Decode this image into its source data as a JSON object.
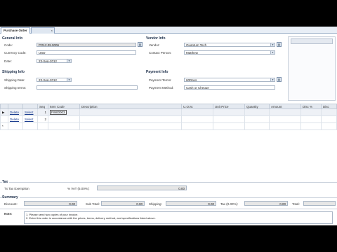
{
  "tabs": [
    "Purchase Order",
    ""
  ],
  "general": {
    "title": "General Info",
    "code_label": "Code:",
    "code_value": "PO12.09.0006",
    "currency_label": "Currency Code:",
    "currency_value": "USD",
    "date_label": "Date:",
    "date_value": "23-Sep-2012"
  },
  "vendor": {
    "title": "Vendor Info",
    "vendor_label": "Vendor:",
    "vendor_value": "Quantum Tech",
    "contact_label": "Contact Person:",
    "contact_value": "Matthew"
  },
  "shipping": {
    "title": "Shipping Info",
    "date_label": "Shipping Date:",
    "date_value": "23-Sep-2012",
    "terms_label": "Shipping terms:",
    "terms_value": ""
  },
  "payment": {
    "title": "Payment Info",
    "terms_label": "Payment Terms:",
    "terms_value": "60Days",
    "method_label": "Payment Method:",
    "method_value": "Cash or Cheque"
  },
  "grid": {
    "headers": [
      "",
      "",
      "",
      "Seq",
      "Item Code",
      "Description",
      "U.O.M.",
      "Unit Price",
      "Quantity",
      "Amount",
      "Disc %",
      "Disc"
    ],
    "rows": [
      {
        "marker": "▶",
        "delete": "Delete",
        "select": "Select",
        "seq": "1",
        "item_code": "FW00003"
      },
      {
        "marker": "",
        "delete": "Delete",
        "select": "Select",
        "seq": "2",
        "item_code": ""
      },
      {
        "marker": "*",
        "delete": "",
        "select": "",
        "seq": "",
        "item_code": ""
      }
    ]
  },
  "tax": {
    "title": "Tax",
    "exempt_label": "Tx Tax Exemption",
    "vat_label": "% VAT (5.00%):",
    "vat_value": "0.00"
  },
  "summary": {
    "title": "Summary",
    "discount_label": "Discount:",
    "discount_value": "0.00",
    "subtotal_label": "Sub Total:",
    "subtotal_value": "0.00",
    "shipping_label": "Shipping:",
    "shipping_value": "0.00",
    "tax_label": "Tax (0.00%):",
    "tax_value": "0.00",
    "total_label": "Total:",
    "total_value": ""
  },
  "notes": {
    "label": "Note:",
    "line1": "1. Please send two copies of your invoice.",
    "line2": "2. Enter this order in accordance with the prices, terms, delivery method, and specifications listed above."
  }
}
